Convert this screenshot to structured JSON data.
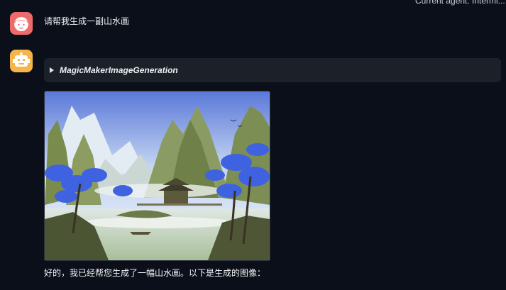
{
  "status_bar": {
    "text": "Current agent: Intermi..."
  },
  "user_message": {
    "avatar_icon": "girl-face-icon",
    "text": "请帮我生成一副山水画"
  },
  "assistant": {
    "avatar_icon": "robot-icon",
    "tool_call": {
      "expand_icon": "triangle-right-icon",
      "name": "MagicMakerImageGeneration"
    },
    "image_subject": "山水画",
    "response_text": "好的，我已经帮您生成了一幅山水画。以下是生成的图像："
  },
  "colors": {
    "background": "#0b0f19",
    "panel": "#1c2129",
    "user_avatar": "#ee6b6b",
    "bot_avatar": "#f6b54a"
  }
}
